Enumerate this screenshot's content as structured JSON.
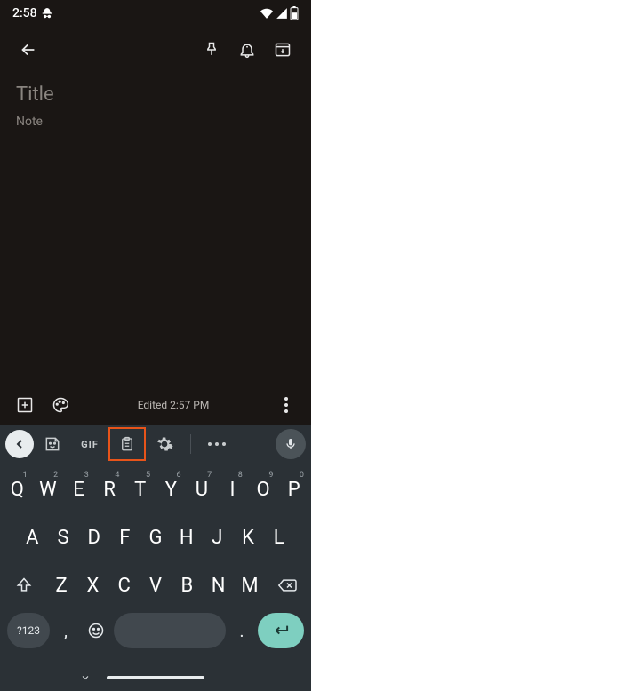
{
  "status": {
    "time": "2:58",
    "incognito": true
  },
  "note": {
    "title_placeholder": "Title",
    "body_placeholder": "Note",
    "edited": "Edited 2:57 PM"
  },
  "keyboard": {
    "gif_label": "GIF",
    "sym_label": "?123",
    "row1": [
      {
        "l": "Q",
        "s": "1"
      },
      {
        "l": "W",
        "s": "2"
      },
      {
        "l": "E",
        "s": "3"
      },
      {
        "l": "R",
        "s": "4"
      },
      {
        "l": "T",
        "s": "5"
      },
      {
        "l": "Y",
        "s": "6"
      },
      {
        "l": "U",
        "s": "7"
      },
      {
        "l": "I",
        "s": "8"
      },
      {
        "l": "O",
        "s": "9"
      },
      {
        "l": "P",
        "s": "0"
      }
    ],
    "row2": [
      "A",
      "S",
      "D",
      "F",
      "G",
      "H",
      "J",
      "K",
      "L"
    ],
    "row3": [
      "Z",
      "X",
      "C",
      "V",
      "B",
      "N",
      "M"
    ],
    "comma": ",",
    "period": "."
  }
}
